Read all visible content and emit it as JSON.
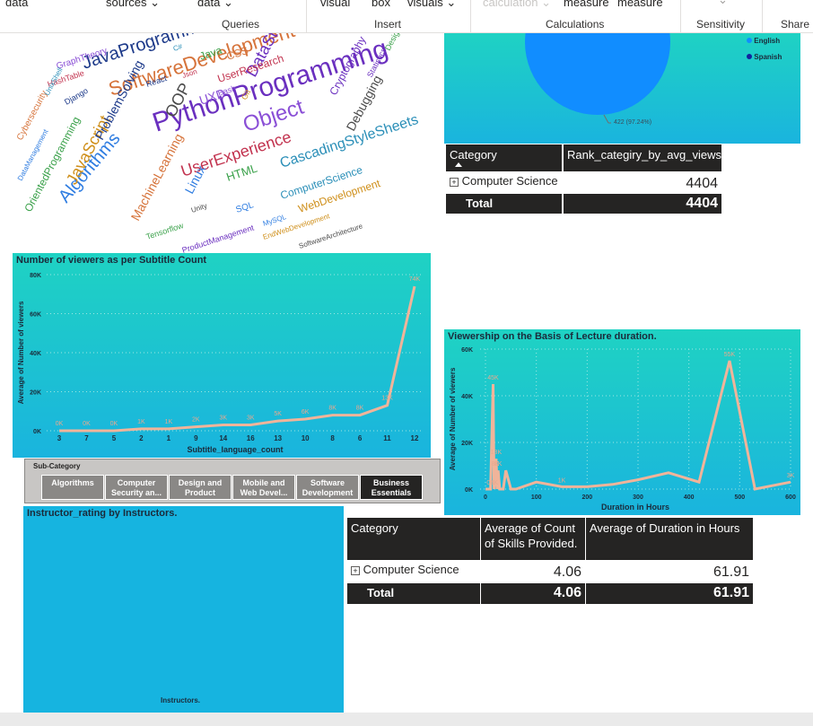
{
  "ribbon": {
    "buttons": [
      "data",
      "sources",
      "data",
      "visual",
      "box",
      "visuals",
      "calculation",
      "measure",
      "measure",
      "Share"
    ],
    "groups": [
      "Queries",
      "Insert",
      "Calculations",
      "Sensitivity"
    ]
  },
  "wordcloud": {
    "words": [
      "PythonProgramming",
      "Algorithms",
      "OrientedProgramming",
      "SoftwareDevelopment",
      "JavaProgramming",
      "UserExperience",
      "Object",
      "CascadingStyleSheets",
      "JavaScript",
      "OOP",
      "DataStructures",
      "Linux",
      "HTML",
      "MachineLearning",
      "ProblemSolving",
      "UserResearch",
      "UXD",
      "ComputerScience",
      "WebDevelopment",
      "Debugging",
      "Cryptography",
      "SQL",
      "Tensorflow",
      "Cybersecurity",
      "Django",
      "HashTable",
      "GraphTheory",
      "UnixShell",
      "EndWebDevelopment",
      "SoftwareArchitecture",
      "ProductManagement",
      "MySQL",
      "Java",
      "CSS",
      "React",
      "Json",
      "Bash",
      "C#",
      "Git",
      "Unity",
      "Statistics",
      "DataManagement",
      "Design"
    ]
  },
  "pie": {
    "label": "422 (97.24%)",
    "legend": [
      "English",
      "Spanish"
    ],
    "colors": [
      "#118dff",
      "#12239e"
    ]
  },
  "table1": {
    "headers": [
      "Category",
      "Rank_categiry_by_avg_views"
    ],
    "row": {
      "category": "Computer Science",
      "value": "4404"
    },
    "total": {
      "label": "Total",
      "value": "4404"
    }
  },
  "chart1": {
    "title": "Number of viewers as per Subtitle Count",
    "chart_data": {
      "type": "line",
      "title": "Number of viewers as per Subtitle Count",
      "xlabel": "Subtitle_language_count",
      "ylabel": "Average of Number of viewers",
      "categories": [
        "3",
        "7",
        "5",
        "2",
        "1",
        "9",
        "14",
        "16",
        "13",
        "10",
        "8",
        "6",
        "11",
        "12"
      ],
      "values": [
        0,
        0,
        0,
        1000,
        1000,
        2000,
        3000,
        3000,
        5000,
        6000,
        8000,
        8000,
        13000,
        74000
      ],
      "labels": [
        "0K",
        "0K",
        "0K",
        "1K",
        "1K",
        "2K",
        "3K",
        "3K",
        "5K",
        "6K",
        "8K",
        "8K",
        "13K",
        "74K"
      ],
      "yticks": [
        "0K",
        "20K",
        "40K",
        "60K",
        "80K"
      ],
      "ylim": [
        0,
        80000
      ]
    }
  },
  "chart2": {
    "title": "Viewership on the Basis of Lecture duration.",
    "chart_data": {
      "type": "line",
      "title": "Viewership on the Basis of Lecture duration.",
      "xlabel": "Duration in Hours",
      "ylabel": "Average of Number of viewers",
      "x": [
        0,
        10,
        15,
        17,
        19,
        21,
        23,
        25,
        28,
        30,
        35,
        40,
        50,
        60,
        100,
        150,
        200,
        250,
        300,
        360,
        420,
        480,
        530,
        600
      ],
      "y": [
        0,
        0,
        45000,
        0,
        8000,
        13000,
        0,
        8000,
        0,
        0,
        0,
        8000,
        0,
        0,
        3000,
        1000,
        1000,
        2000,
        4000,
        7000,
        3000,
        55000,
        0,
        3000
      ],
      "labels": [
        "45K",
        "13K",
        "8K",
        "8K",
        "0K",
        "0K",
        "1K",
        "55K",
        "3K"
      ],
      "xticks": [
        "0",
        "100",
        "200",
        "300",
        "400",
        "500",
        "600"
      ],
      "yticks": [
        "0K",
        "20K",
        "40K",
        "60K"
      ],
      "xlim": [
        0,
        600
      ],
      "ylim": [
        0,
        60000
      ]
    }
  },
  "slicer": {
    "title": "Sub-Category",
    "items": [
      "Algorithms",
      "Computer Security an...",
      "Design and Product",
      "Mobile and Web Devel...",
      "Software Development",
      "Business Essentials"
    ],
    "selected_index": 5
  },
  "instructor": {
    "title": "Instructor_rating by Instructors.",
    "xlabel": "Instructors."
  },
  "table2": {
    "headers": [
      "Category",
      "Average of Count of Skills Provided.",
      "Average of Duration in Hours"
    ],
    "row": {
      "category": "Computer Science",
      "v1": "4.06",
      "v2": "61.91"
    },
    "total": {
      "label": "Total",
      "v1": "4.06",
      "v2": "61.91"
    }
  }
}
